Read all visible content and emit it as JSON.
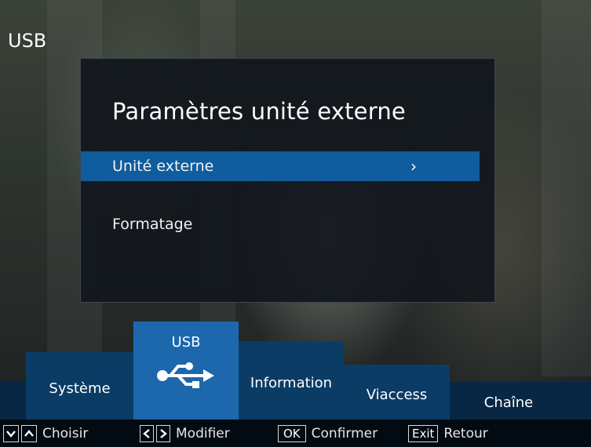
{
  "screen": {
    "title": "USB"
  },
  "panel": {
    "title": "Paramètres unité externe",
    "items": [
      {
        "label": "Unité externe",
        "selected": true,
        "has_submenu": true,
        "chevron": "›"
      },
      {
        "label": "Formatage",
        "selected": false
      }
    ]
  },
  "tabs": [
    {
      "label": "Système",
      "active": false
    },
    {
      "label": "USB",
      "active": true,
      "icon": "usb-icon"
    },
    {
      "label": "Information",
      "active": false
    },
    {
      "label": "Viaccess",
      "active": false
    },
    {
      "label": "Chaîne",
      "active": false
    }
  ],
  "help": {
    "choose_label": "Choisir",
    "modify_label": "Modifier",
    "ok_key": "OK",
    "confirm_label": "Confirmer",
    "exit_key": "Exit",
    "back_label": "Retour"
  },
  "colors": {
    "highlight": "#0f5c9e",
    "active_tab": "#1d68ad",
    "inactive_tab": "#0b3c66",
    "tab_strip": "#072744"
  }
}
